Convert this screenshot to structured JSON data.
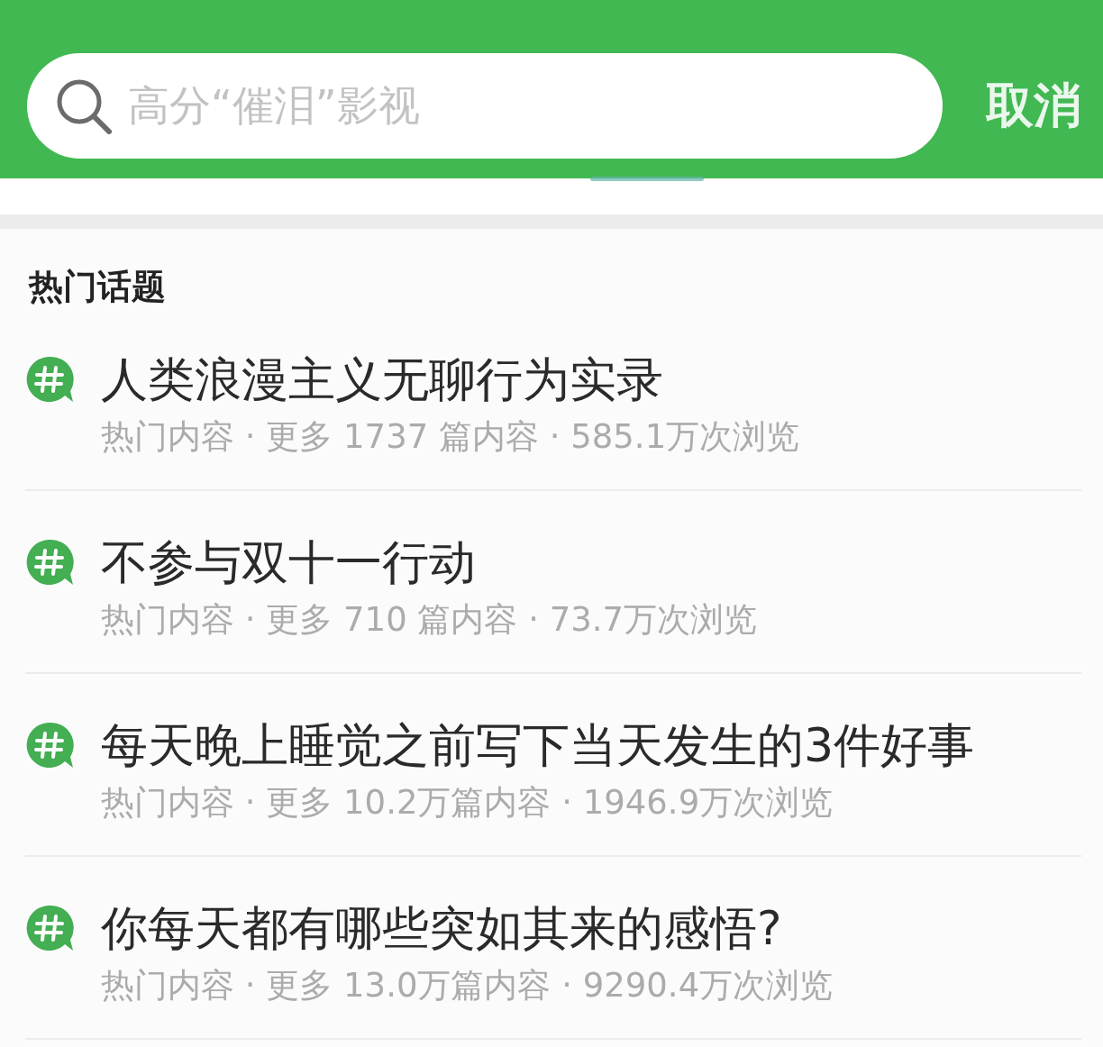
{
  "search": {
    "placeholder": "高分“催泪”影视",
    "cancel": "取消"
  },
  "section": {
    "title": "热门话题"
  },
  "topics": [
    {
      "title": "人类浪漫主义无聊行为实录",
      "meta": "热门内容 · 更多 1737 篇内容 · 585.1万次浏览"
    },
    {
      "title": "不参与双十一行动",
      "meta": "热门内容 · 更多 710 篇内容 · 73.7万次浏览"
    },
    {
      "title": "每天晚上睡觉之前写下当天发生的3件好事",
      "meta": "热门内容 · 更多 10.2万篇内容 · 1946.9万次浏览"
    },
    {
      "title": "你每天都有哪些突如其来的感悟?",
      "meta": "热门内容 · 更多 13.0万篇内容 · 9290.4万次浏览"
    }
  ]
}
